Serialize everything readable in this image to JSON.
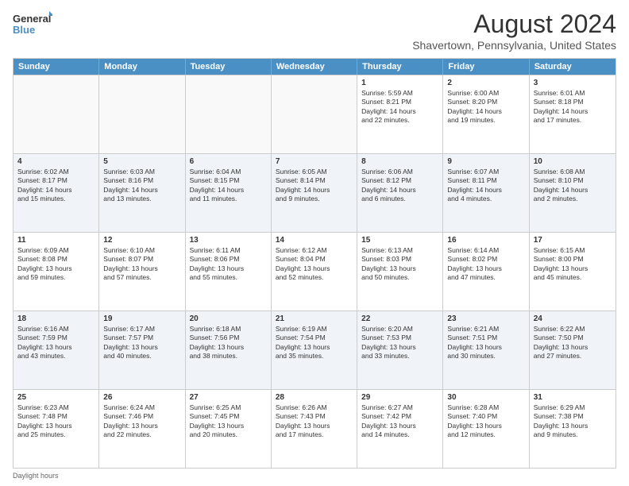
{
  "logo": {
    "line1": "General",
    "line2": "Blue"
  },
  "title": "August 2024",
  "subtitle": "Shavertown, Pennsylvania, United States",
  "days": [
    "Sunday",
    "Monday",
    "Tuesday",
    "Wednesday",
    "Thursday",
    "Friday",
    "Saturday"
  ],
  "footer": "Daylight hours",
  "rows": [
    [
      {
        "num": "",
        "text": ""
      },
      {
        "num": "",
        "text": ""
      },
      {
        "num": "",
        "text": ""
      },
      {
        "num": "",
        "text": ""
      },
      {
        "num": "1",
        "text": "Sunrise: 5:59 AM\nSunset: 8:21 PM\nDaylight: 14 hours\nand 22 minutes."
      },
      {
        "num": "2",
        "text": "Sunrise: 6:00 AM\nSunset: 8:20 PM\nDaylight: 14 hours\nand 19 minutes."
      },
      {
        "num": "3",
        "text": "Sunrise: 6:01 AM\nSunset: 8:18 PM\nDaylight: 14 hours\nand 17 minutes."
      }
    ],
    [
      {
        "num": "4",
        "text": "Sunrise: 6:02 AM\nSunset: 8:17 PM\nDaylight: 14 hours\nand 15 minutes."
      },
      {
        "num": "5",
        "text": "Sunrise: 6:03 AM\nSunset: 8:16 PM\nDaylight: 14 hours\nand 13 minutes."
      },
      {
        "num": "6",
        "text": "Sunrise: 6:04 AM\nSunset: 8:15 PM\nDaylight: 14 hours\nand 11 minutes."
      },
      {
        "num": "7",
        "text": "Sunrise: 6:05 AM\nSunset: 8:14 PM\nDaylight: 14 hours\nand 9 minutes."
      },
      {
        "num": "8",
        "text": "Sunrise: 6:06 AM\nSunset: 8:12 PM\nDaylight: 14 hours\nand 6 minutes."
      },
      {
        "num": "9",
        "text": "Sunrise: 6:07 AM\nSunset: 8:11 PM\nDaylight: 14 hours\nand 4 minutes."
      },
      {
        "num": "10",
        "text": "Sunrise: 6:08 AM\nSunset: 8:10 PM\nDaylight: 14 hours\nand 2 minutes."
      }
    ],
    [
      {
        "num": "11",
        "text": "Sunrise: 6:09 AM\nSunset: 8:08 PM\nDaylight: 13 hours\nand 59 minutes."
      },
      {
        "num": "12",
        "text": "Sunrise: 6:10 AM\nSunset: 8:07 PM\nDaylight: 13 hours\nand 57 minutes."
      },
      {
        "num": "13",
        "text": "Sunrise: 6:11 AM\nSunset: 8:06 PM\nDaylight: 13 hours\nand 55 minutes."
      },
      {
        "num": "14",
        "text": "Sunrise: 6:12 AM\nSunset: 8:04 PM\nDaylight: 13 hours\nand 52 minutes."
      },
      {
        "num": "15",
        "text": "Sunrise: 6:13 AM\nSunset: 8:03 PM\nDaylight: 13 hours\nand 50 minutes."
      },
      {
        "num": "16",
        "text": "Sunrise: 6:14 AM\nSunset: 8:02 PM\nDaylight: 13 hours\nand 47 minutes."
      },
      {
        "num": "17",
        "text": "Sunrise: 6:15 AM\nSunset: 8:00 PM\nDaylight: 13 hours\nand 45 minutes."
      }
    ],
    [
      {
        "num": "18",
        "text": "Sunrise: 6:16 AM\nSunset: 7:59 PM\nDaylight: 13 hours\nand 43 minutes."
      },
      {
        "num": "19",
        "text": "Sunrise: 6:17 AM\nSunset: 7:57 PM\nDaylight: 13 hours\nand 40 minutes."
      },
      {
        "num": "20",
        "text": "Sunrise: 6:18 AM\nSunset: 7:56 PM\nDaylight: 13 hours\nand 38 minutes."
      },
      {
        "num": "21",
        "text": "Sunrise: 6:19 AM\nSunset: 7:54 PM\nDaylight: 13 hours\nand 35 minutes."
      },
      {
        "num": "22",
        "text": "Sunrise: 6:20 AM\nSunset: 7:53 PM\nDaylight: 13 hours\nand 33 minutes."
      },
      {
        "num": "23",
        "text": "Sunrise: 6:21 AM\nSunset: 7:51 PM\nDaylight: 13 hours\nand 30 minutes."
      },
      {
        "num": "24",
        "text": "Sunrise: 6:22 AM\nSunset: 7:50 PM\nDaylight: 13 hours\nand 27 minutes."
      }
    ],
    [
      {
        "num": "25",
        "text": "Sunrise: 6:23 AM\nSunset: 7:48 PM\nDaylight: 13 hours\nand 25 minutes."
      },
      {
        "num": "26",
        "text": "Sunrise: 6:24 AM\nSunset: 7:46 PM\nDaylight: 13 hours\nand 22 minutes."
      },
      {
        "num": "27",
        "text": "Sunrise: 6:25 AM\nSunset: 7:45 PM\nDaylight: 13 hours\nand 20 minutes."
      },
      {
        "num": "28",
        "text": "Sunrise: 6:26 AM\nSunset: 7:43 PM\nDaylight: 13 hours\nand 17 minutes."
      },
      {
        "num": "29",
        "text": "Sunrise: 6:27 AM\nSunset: 7:42 PM\nDaylight: 13 hours\nand 14 minutes."
      },
      {
        "num": "30",
        "text": "Sunrise: 6:28 AM\nSunset: 7:40 PM\nDaylight: 13 hours\nand 12 minutes."
      },
      {
        "num": "31",
        "text": "Sunrise: 6:29 AM\nSunset: 7:38 PM\nDaylight: 13 hours\nand 9 minutes."
      }
    ]
  ]
}
